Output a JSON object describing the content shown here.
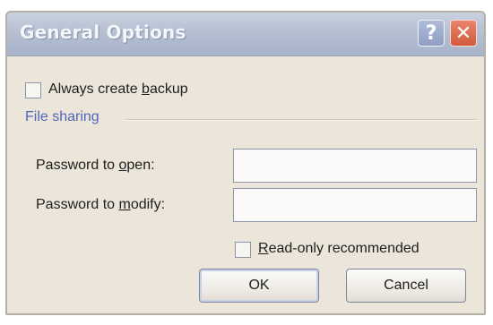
{
  "dialog": {
    "title": "General Options",
    "help_icon_glyph": "?",
    "close_icon_glyph": "✕"
  },
  "backup": {
    "label_pre": "Always create ",
    "label_accel": "b",
    "label_post": "ackup",
    "checked": false
  },
  "file_sharing": {
    "group_label": "File sharing",
    "password_open": {
      "label_pre": "Password to ",
      "label_accel": "o",
      "label_post": "pen:",
      "value": ""
    },
    "password_modify": {
      "label_pre": "Password to ",
      "label_accel": "m",
      "label_post": "odify:",
      "value": ""
    },
    "read_only": {
      "label_pre": "",
      "label_accel": "R",
      "label_post": "ead-only recommended",
      "checked": false
    }
  },
  "buttons": {
    "ok_label": "OK",
    "cancel_label": "Cancel"
  },
  "colors": {
    "titlebar": "#b6c0d3",
    "dialog_bg": "#ece6da",
    "group_title": "#4f66b8",
    "close_button": "#d25a3c"
  }
}
